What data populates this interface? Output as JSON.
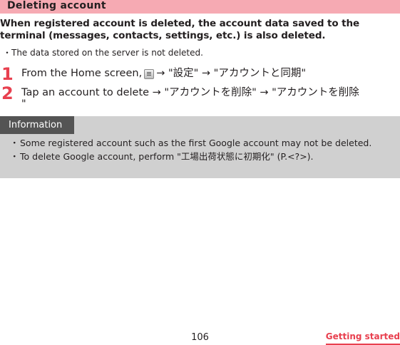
{
  "section_title": "Deleting account",
  "lead": {
    "line1": "When registered account is deleted, the account data saved to the",
    "line2": "terminal (messages, contacts, settings, etc.) is also deleted."
  },
  "note": {
    "bullet": "・",
    "text": "The data stored on the server is not deleted."
  },
  "steps": [
    {
      "number": "1",
      "before_icon": "From the Home screen,",
      "icon": "menu-key-icon",
      "after_icon": "→ \"設定\" → \"アカウントと同期\""
    },
    {
      "number": "2",
      "text": "Tap an account to delete → \"アカウントを削除\" → \"アカウントを削除",
      "continuation": "\""
    }
  ],
  "information": {
    "label": "Information",
    "bullet": "・",
    "items": [
      "Some registered account such as the first Google account may not be deleted.",
      "To delete Google account, perform \"工場出荷状態に初期化\" (P.<?>)."
    ]
  },
  "footer": {
    "page_number": "106",
    "section": "Getting started"
  },
  "colors": {
    "header_bg": "#f6aab3",
    "accent": "#e8404f",
    "info_bg": "#d0d0d0",
    "info_tab_bg": "#545454"
  }
}
